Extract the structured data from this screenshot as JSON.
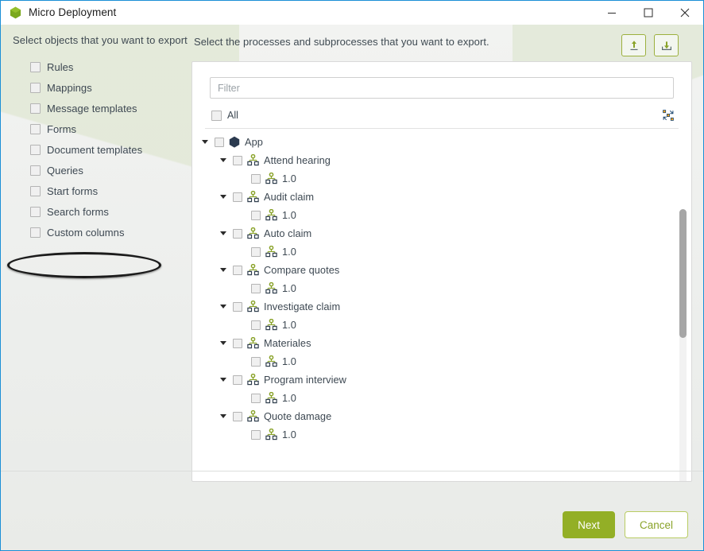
{
  "window": {
    "title": "Micro Deployment",
    "icon": "hexagon-icon",
    "minimize_label": "—",
    "maximize_label": "□",
    "close_label": "✕",
    "accent_green": "#93af26",
    "border_blue": "#1b8fd6"
  },
  "left_pane": {
    "heading": "Select objects that you want to export",
    "items": [
      {
        "label": "Rules",
        "checked": false
      },
      {
        "label": "Mappings",
        "checked": false
      },
      {
        "label": "Message templates",
        "checked": false
      },
      {
        "label": "Forms",
        "checked": false
      },
      {
        "label": "Document templates",
        "checked": false
      },
      {
        "label": "Queries",
        "checked": false
      },
      {
        "label": "Start forms",
        "checked": false
      },
      {
        "label": "Search forms",
        "checked": false
      },
      {
        "label": "Custom columns",
        "checked": false
      }
    ],
    "highlighted_item": "Custom columns"
  },
  "right_pane": {
    "heading": "Select the processes and subprocesses that you want to export.",
    "toolbar": [
      {
        "name": "export-upload-button",
        "icon": "upload-arrow-icon"
      },
      {
        "name": "import-download-button",
        "icon": "download-tray-icon"
      }
    ],
    "filter": {
      "placeholder": "Filter",
      "value": ""
    },
    "select_all": {
      "label": "All",
      "checked": false
    },
    "collapse_all_icon": "collapse-all-icon",
    "tree": [
      {
        "level": 0,
        "label": "App",
        "icon": "hexagon-dark-icon",
        "expanded": true,
        "checked": false
      },
      {
        "level": 1,
        "label": "Attend hearing",
        "icon": "process-icon",
        "expanded": true,
        "checked": false
      },
      {
        "level": 2,
        "label": "1.0",
        "icon": "process-icon",
        "expanded": null,
        "checked": false
      },
      {
        "level": 1,
        "label": "Audit claim",
        "icon": "process-icon",
        "expanded": true,
        "checked": false
      },
      {
        "level": 2,
        "label": "1.0",
        "icon": "process-icon",
        "expanded": null,
        "checked": false
      },
      {
        "level": 1,
        "label": "Auto claim",
        "icon": "process-icon",
        "expanded": true,
        "checked": false
      },
      {
        "level": 2,
        "label": "1.0",
        "icon": "process-icon",
        "expanded": null,
        "checked": false
      },
      {
        "level": 1,
        "label": "Compare quotes",
        "icon": "process-icon",
        "expanded": true,
        "checked": false
      },
      {
        "level": 2,
        "label": "1.0",
        "icon": "process-icon",
        "expanded": null,
        "checked": false
      },
      {
        "level": 1,
        "label": "Investigate claim",
        "icon": "process-icon",
        "expanded": true,
        "checked": false
      },
      {
        "level": 2,
        "label": "1.0",
        "icon": "process-icon",
        "expanded": null,
        "checked": false
      },
      {
        "level": 1,
        "label": "Materiales",
        "icon": "process-icon",
        "expanded": true,
        "checked": false
      },
      {
        "level": 2,
        "label": "1.0",
        "icon": "process-icon",
        "expanded": null,
        "checked": false
      },
      {
        "level": 1,
        "label": "Program interview",
        "icon": "process-icon",
        "expanded": true,
        "checked": false
      },
      {
        "level": 2,
        "label": "1.0",
        "icon": "process-icon",
        "expanded": null,
        "checked": false
      },
      {
        "level": 1,
        "label": "Quote damage",
        "icon": "process-icon",
        "expanded": true,
        "checked": false
      },
      {
        "level": 2,
        "label": "1.0",
        "icon": "process-icon",
        "expanded": null,
        "checked": false
      }
    ]
  },
  "footer": {
    "next_label": "Next",
    "cancel_label": "Cancel"
  }
}
